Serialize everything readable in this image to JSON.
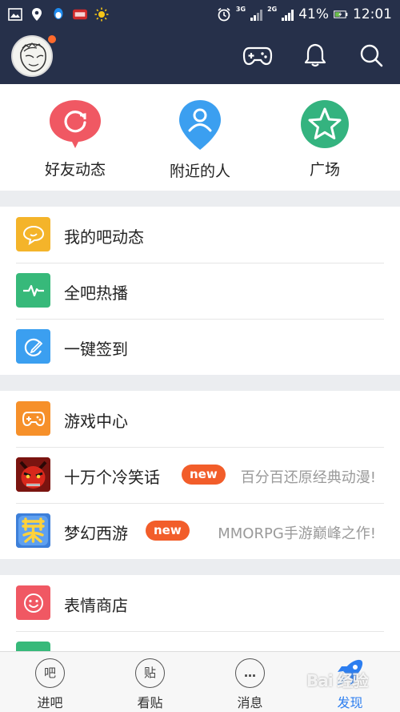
{
  "status_bar": {
    "battery_percent": "41%",
    "time": "12:01",
    "net_3g": "3G",
    "net_2g": "2G"
  },
  "features": [
    {
      "label": "好友动态",
      "color": "#f05863",
      "icon": "refresh-bubble-icon"
    },
    {
      "label": "附近的人",
      "color": "#3b9ff0",
      "icon": "person-pin-icon"
    },
    {
      "label": "广场",
      "color": "#34b37f",
      "icon": "star-icon"
    }
  ],
  "groups": [
    {
      "items": [
        {
          "label": "我的吧动态",
          "color": "#f4b42a",
          "icon": "chat-bubble-icon"
        },
        {
          "label": "全吧热播",
          "color": "#37b97a",
          "icon": "pulse-icon"
        },
        {
          "label": "一键签到",
          "color": "#3b9ff0",
          "icon": "sign-in-icon"
        }
      ]
    },
    {
      "items": [
        {
          "label": "游戏中心",
          "color": "#f6902a",
          "icon": "gamepad-icon"
        },
        {
          "label": "十万个冷笑话",
          "color": "#b71f17",
          "icon": "game-avatar-icon",
          "badge": "new",
          "desc": "百分百还原经典动漫!"
        },
        {
          "label": "梦幻西游",
          "color": "#2f7ee0",
          "icon": "game-logo-icon",
          "badge": "new",
          "desc": "MMORPG手游巅峰之作!"
        }
      ]
    },
    {
      "items": [
        {
          "label": "表情商店",
          "color": "#f05863",
          "icon": "smiley-icon"
        }
      ]
    }
  ],
  "bottom_nav": [
    {
      "label": "进吧",
      "glyph": "吧"
    },
    {
      "label": "看贴",
      "glyph": "贴"
    },
    {
      "label": "消息",
      "glyph": "…"
    },
    {
      "label": "发现",
      "glyph": ""
    }
  ],
  "watermark": "Bai 经验",
  "colors": {
    "header_bg": "#26304a",
    "accent_blue": "#2c7ef0",
    "badge_orange": "#f25d2a"
  }
}
